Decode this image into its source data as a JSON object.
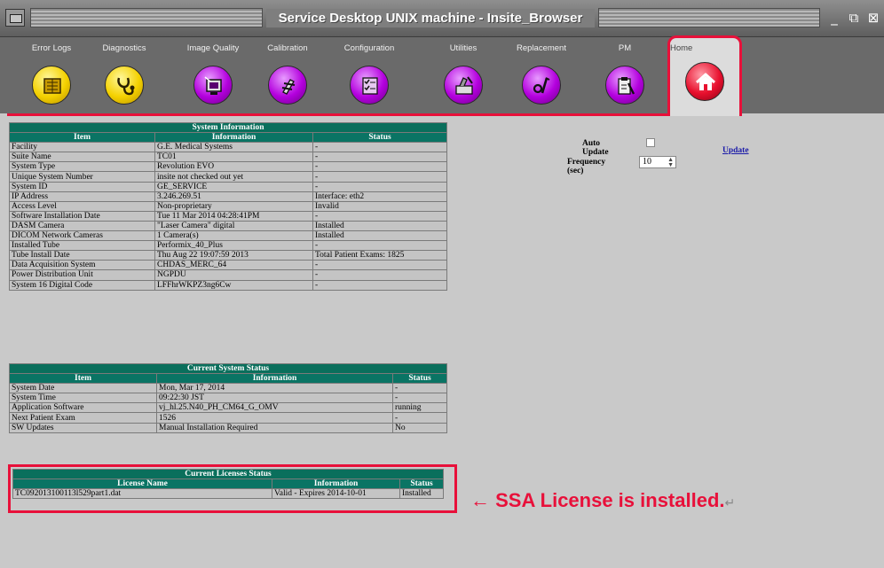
{
  "window": {
    "title": "Service Desktop UNIX machine - Insite_Browser",
    "min_glyph": "_",
    "max_glyph": "⧉",
    "close_glyph": "⊠"
  },
  "toolbar": {
    "items": [
      {
        "label": "Error Logs",
        "icon": "error-logs-icon",
        "color": "yellow"
      },
      {
        "label": "Diagnostics",
        "icon": "diagnostics-icon",
        "color": "yellow"
      },
      {
        "label": "Image Quality",
        "icon": "image-quality-icon",
        "color": "purple"
      },
      {
        "label": "Calibration",
        "icon": "calibration-icon",
        "color": "purple"
      },
      {
        "label": "Configuration",
        "icon": "configuration-icon",
        "color": "purple"
      },
      {
        "label": "Utilities",
        "icon": "utilities-icon",
        "color": "purple"
      },
      {
        "label": "Replacement",
        "icon": "replacement-icon",
        "color": "purple"
      },
      {
        "label": "PM",
        "icon": "pm-icon",
        "color": "purple"
      }
    ],
    "home": {
      "label": "Home",
      "icon": "home-icon",
      "color": "red"
    }
  },
  "system_information": {
    "caption": "System Information",
    "headers": [
      "Item",
      "Information",
      "Status"
    ],
    "rows": [
      [
        "Facility",
        "G.E. Medical Systems",
        "-"
      ],
      [
        "Suite Name",
        "TC01",
        "-"
      ],
      [
        "System Type",
        "Revolution EVO",
        "-"
      ],
      [
        "Unique System Number",
        "insite not checked out yet",
        "-"
      ],
      [
        "System ID",
        "GE_SERVICE",
        "-"
      ],
      [
        "IP Address",
        "3.246.269.51",
        "Interface: eth2"
      ],
      [
        "Access Level",
        "Non-proprietary",
        "Invalid"
      ],
      [
        "Software Installation Date",
        "Tue 11 Mar 2014 04:28:41PM",
        "-"
      ],
      [
        "DASM Camera",
        "\"Laser Camera\" digital",
        "Installed"
      ],
      [
        "DICOM Network Cameras",
        "1 Camera(s)",
        "Installed"
      ],
      [
        "Installed Tube",
        "Performix_40_Plus",
        "-"
      ],
      [
        "Tube Install Date",
        "Thu Aug 22 19:07:59 2013",
        "Total Patient Exams: 1825"
      ],
      [
        "Data Acquisition System",
        "CHDAS_MERC_64",
        "-"
      ],
      [
        "Power Distribution Unit",
        "NGPDU",
        "-"
      ],
      [
        "System 16 Digital Code",
        "LFFhrWKPZ3ng6Cw",
        "-"
      ]
    ]
  },
  "current_system_status": {
    "caption": "Current System Status",
    "headers": [
      "Item",
      "Information",
      "Status"
    ],
    "rows": [
      [
        "System Date",
        "Mon, Mar 17, 2014",
        "-"
      ],
      [
        "System Time",
        "09:22:30 JST",
        "-"
      ],
      [
        "Application Software",
        "vj_hl.25.N40_PH_CM64_G_OMV",
        "running"
      ],
      [
        "Next Patient Exam",
        "1526",
        "-"
      ],
      [
        "SW Updates",
        "Manual Installation Required",
        "No"
      ]
    ]
  },
  "current_licenses_status": {
    "caption": "Current Licenses Status",
    "headers": [
      "License Name",
      "Information",
      "Status"
    ],
    "rows": [
      [
        "TC092013100113l529part1.dat",
        "Valid - Expires 2014-10-01",
        "Installed"
      ]
    ]
  },
  "right_panel": {
    "auto_update_label": "Auto Update",
    "frequency_label": "Frequency (sec)",
    "frequency_value": "10",
    "update_link": "Update"
  },
  "annotation": {
    "text": "← SSA License is installed.",
    "mark": "↵"
  },
  "colors": {
    "header_teal": "#0a7464",
    "highlight_red": "#e8103a",
    "toolbar_gray": "#6a6a6a",
    "content_gray": "#c9c9c9"
  }
}
